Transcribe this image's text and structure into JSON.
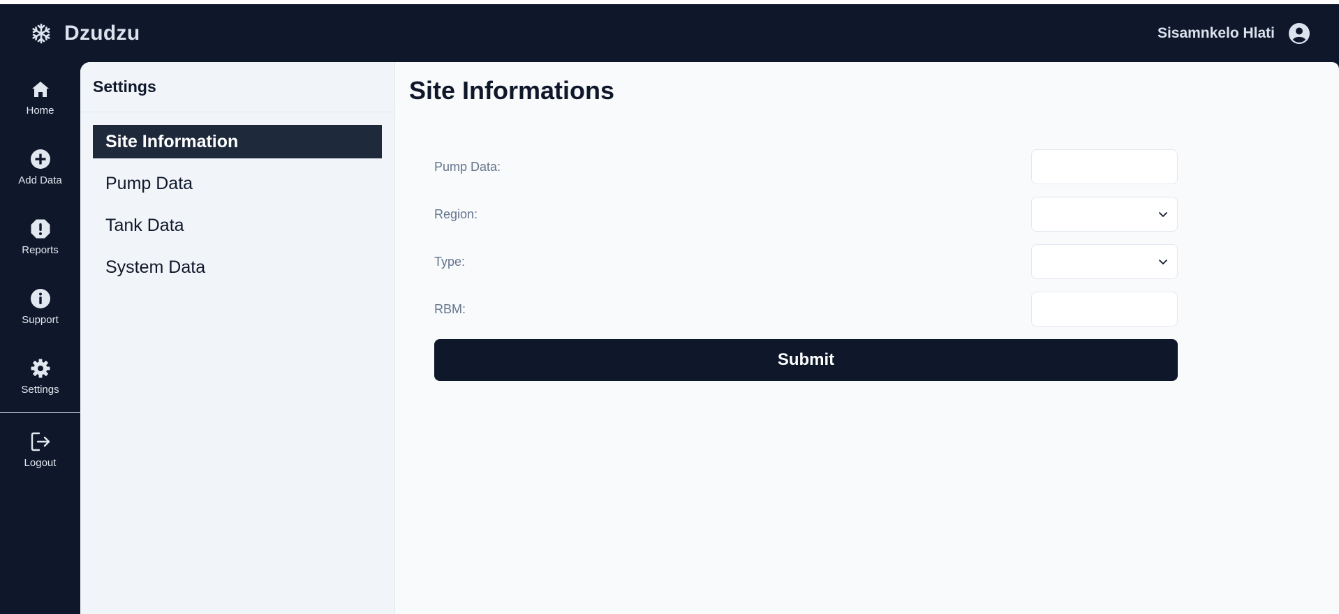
{
  "app": {
    "name": "Dzudzu",
    "brand_icon": "snowflake-icon"
  },
  "user": {
    "name": "Sisamnkelo Hlati",
    "avatar_icon": "user-circle-icon"
  },
  "rail": {
    "items": [
      {
        "label": "Home",
        "icon": "home-icon"
      },
      {
        "label": "Add Data",
        "icon": "plus-circle-icon"
      },
      {
        "label": "Reports",
        "icon": "alert-octagon-icon"
      },
      {
        "label": "Support",
        "icon": "info-circle-icon"
      },
      {
        "label": "Settings",
        "icon": "gear-icon"
      },
      {
        "label": "Logout",
        "icon": "logout-icon"
      }
    ]
  },
  "settings": {
    "title": "Settings",
    "items": [
      {
        "label": "Site Information",
        "active": true
      },
      {
        "label": "Pump Data",
        "active": false
      },
      {
        "label": "Tank Data",
        "active": false
      },
      {
        "label": "System Data",
        "active": false
      }
    ]
  },
  "main": {
    "title": "Site Informations",
    "form": {
      "fields": [
        {
          "label": "Pump Data:",
          "kind": "text",
          "value": ""
        },
        {
          "label": "Region:",
          "kind": "select",
          "value": ""
        },
        {
          "label": "Type:",
          "kind": "select",
          "value": ""
        },
        {
          "label": "RBM:",
          "kind": "text",
          "value": ""
        }
      ],
      "submit_label": "Submit"
    }
  },
  "colors": {
    "shell": "#0f172a",
    "panel": "#f8fafc",
    "settings_bg": "#f1f5f9",
    "active_item": "#1e293b",
    "label_text": "#64748b"
  }
}
